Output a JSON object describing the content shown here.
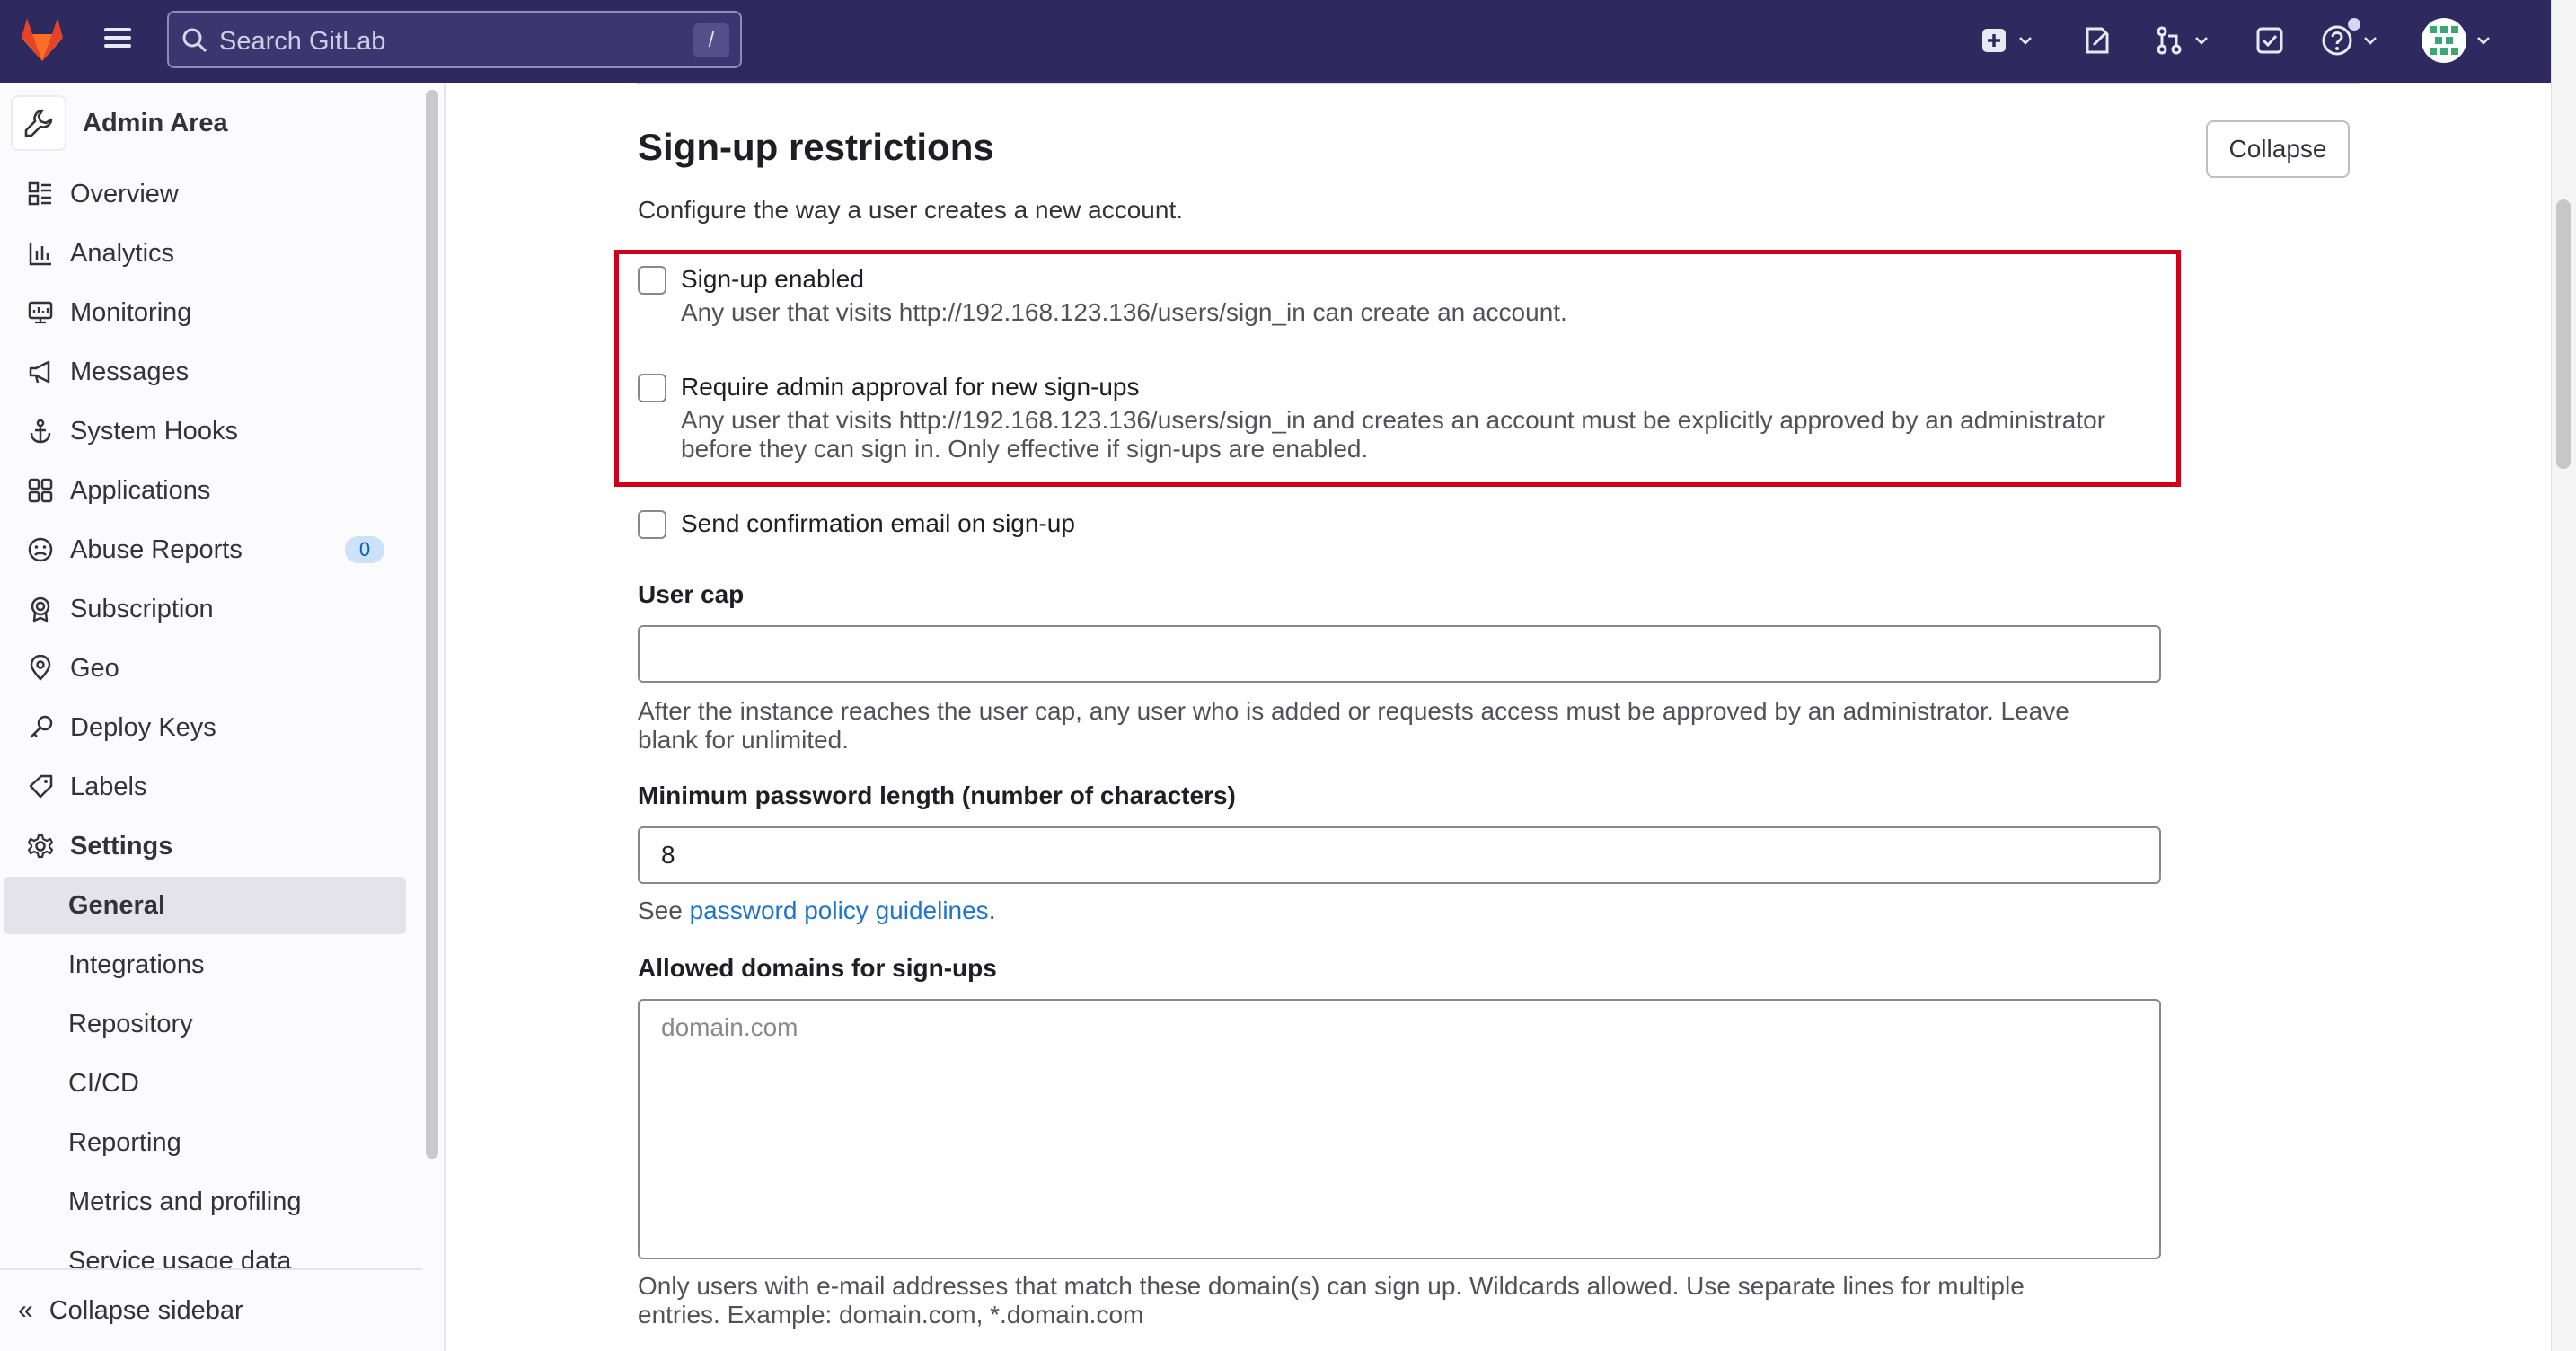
{
  "topbar": {
    "search_placeholder": "Search GitLab",
    "search_shortcut": "/",
    "icons": [
      "gitlab-logo",
      "menu-icon",
      "search-icon",
      "create-new-icon",
      "issues-icon",
      "merge-requests-icon",
      "todos-icon",
      "help-icon",
      "user-avatar"
    ]
  },
  "sidebar": {
    "title": "Admin Area",
    "items": [
      {
        "label": "Overview",
        "icon": "overview-icon"
      },
      {
        "label": "Analytics",
        "icon": "analytics-icon"
      },
      {
        "label": "Monitoring",
        "icon": "monitoring-icon"
      },
      {
        "label": "Messages",
        "icon": "messages-icon"
      },
      {
        "label": "System Hooks",
        "icon": "hook-icon"
      },
      {
        "label": "Applications",
        "icon": "applications-icon"
      },
      {
        "label": "Abuse Reports",
        "icon": "abuse-icon",
        "badge": "0"
      },
      {
        "label": "Subscription",
        "icon": "subscription-icon"
      },
      {
        "label": "Geo",
        "icon": "geo-icon"
      },
      {
        "label": "Deploy Keys",
        "icon": "key-icon"
      },
      {
        "label": "Labels",
        "icon": "label-icon"
      },
      {
        "label": "Settings",
        "icon": "settings-icon"
      }
    ],
    "settings_sub": [
      {
        "label": "General",
        "active": true
      },
      {
        "label": "Integrations"
      },
      {
        "label": "Repository"
      },
      {
        "label": "CI/CD"
      },
      {
        "label": "Reporting"
      },
      {
        "label": "Metrics and profiling"
      },
      {
        "label": "Service usage data"
      }
    ],
    "collapse_label": "Collapse sidebar"
  },
  "section": {
    "title": "Sign-up restrictions",
    "collapse_button": "Collapse",
    "description": "Configure the way a user creates a new account.",
    "signup_enabled": {
      "label": "Sign-up enabled",
      "help": "Any user that visits http://192.168.123.136/users/sign_in can create an account.",
      "checked": false
    },
    "admin_approval": {
      "label": "Require admin approval for new sign-ups",
      "help_line1": "Any user that visits http://192.168.123.136/users/sign_in and creates an account must be explicitly approved by an administrator",
      "help_line2": "before they can sign in. Only effective if sign-ups are enabled.",
      "checked": false
    },
    "send_confirmation": {
      "label": "Send confirmation email on sign-up",
      "checked": false
    },
    "user_cap": {
      "label": "User cap",
      "value": "",
      "help_line1": "After the instance reaches the user cap, any user who is added or requests access must be approved by an administrator. Leave",
      "help_line2": "blank for unlimited."
    },
    "min_password": {
      "label": "Minimum password length (number of characters)",
      "value": "8",
      "help_prefix": "See ",
      "help_link": "password policy guidelines",
      "help_suffix": "."
    },
    "allowed_domains": {
      "label": "Allowed domains for sign-ups",
      "placeholder": "domain.com",
      "help_line1": "Only users with e-mail addresses that match these domain(s) can sign up. Wildcards allowed. Use separate lines for multiple",
      "help_line2": "entries. Example: domain.com, *.domain.com"
    }
  },
  "colors": {
    "topbar": "#2e2a5f",
    "highlight_border": "#cc0019",
    "link": "#1f75cb"
  }
}
